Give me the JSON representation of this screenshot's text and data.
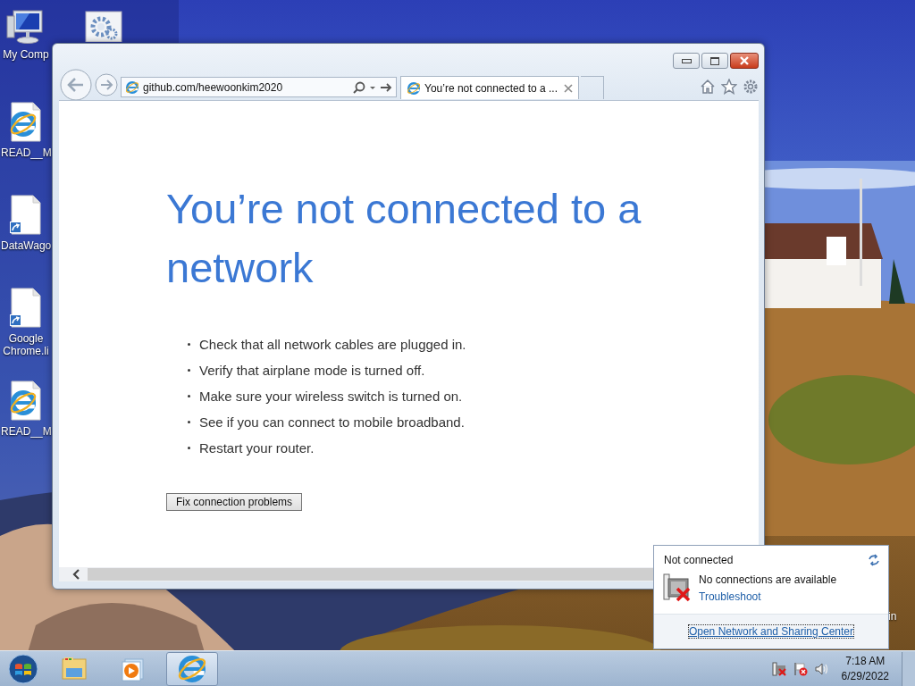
{
  "desktop_icons": [
    {
      "kind": "computer",
      "label": "My Comp"
    },
    {
      "kind": "ie-doc",
      "label": "READ__M"
    },
    {
      "kind": "shortcut",
      "label": "DataWago"
    },
    {
      "kind": "shortcut",
      "label": "Google Chrome.li"
    },
    {
      "kind": "ie-doc",
      "label": "READ__M"
    }
  ],
  "desktop_fragment": "in",
  "browser": {
    "address": "github.com/heewoonkim2020",
    "tabs": [
      {
        "title": "You’re not connected to a ...",
        "selected": true
      }
    ],
    "page": {
      "heading": "You’re not connected to a network",
      "tips": [
        "Check that all network cables are plugged in.",
        "Verify that airplane mode is turned off.",
        "Make sure your wireless switch is turned on.",
        "See if you can connect to mobile broadband.",
        "Restart your router."
      ],
      "button": "Fix connection problems"
    }
  },
  "network_flyout": {
    "status": "Not connected",
    "message": "No connections are available",
    "link": "Troubleshoot",
    "footer_link": "Open Network and Sharing Center"
  },
  "taskbar": {
    "apps": [
      {
        "kind": "explorer",
        "selected": false
      },
      {
        "kind": "media",
        "selected": false
      },
      {
        "kind": "ie",
        "selected": true
      }
    ],
    "time": "7:18 AM",
    "date": "6/29/2022"
  }
}
